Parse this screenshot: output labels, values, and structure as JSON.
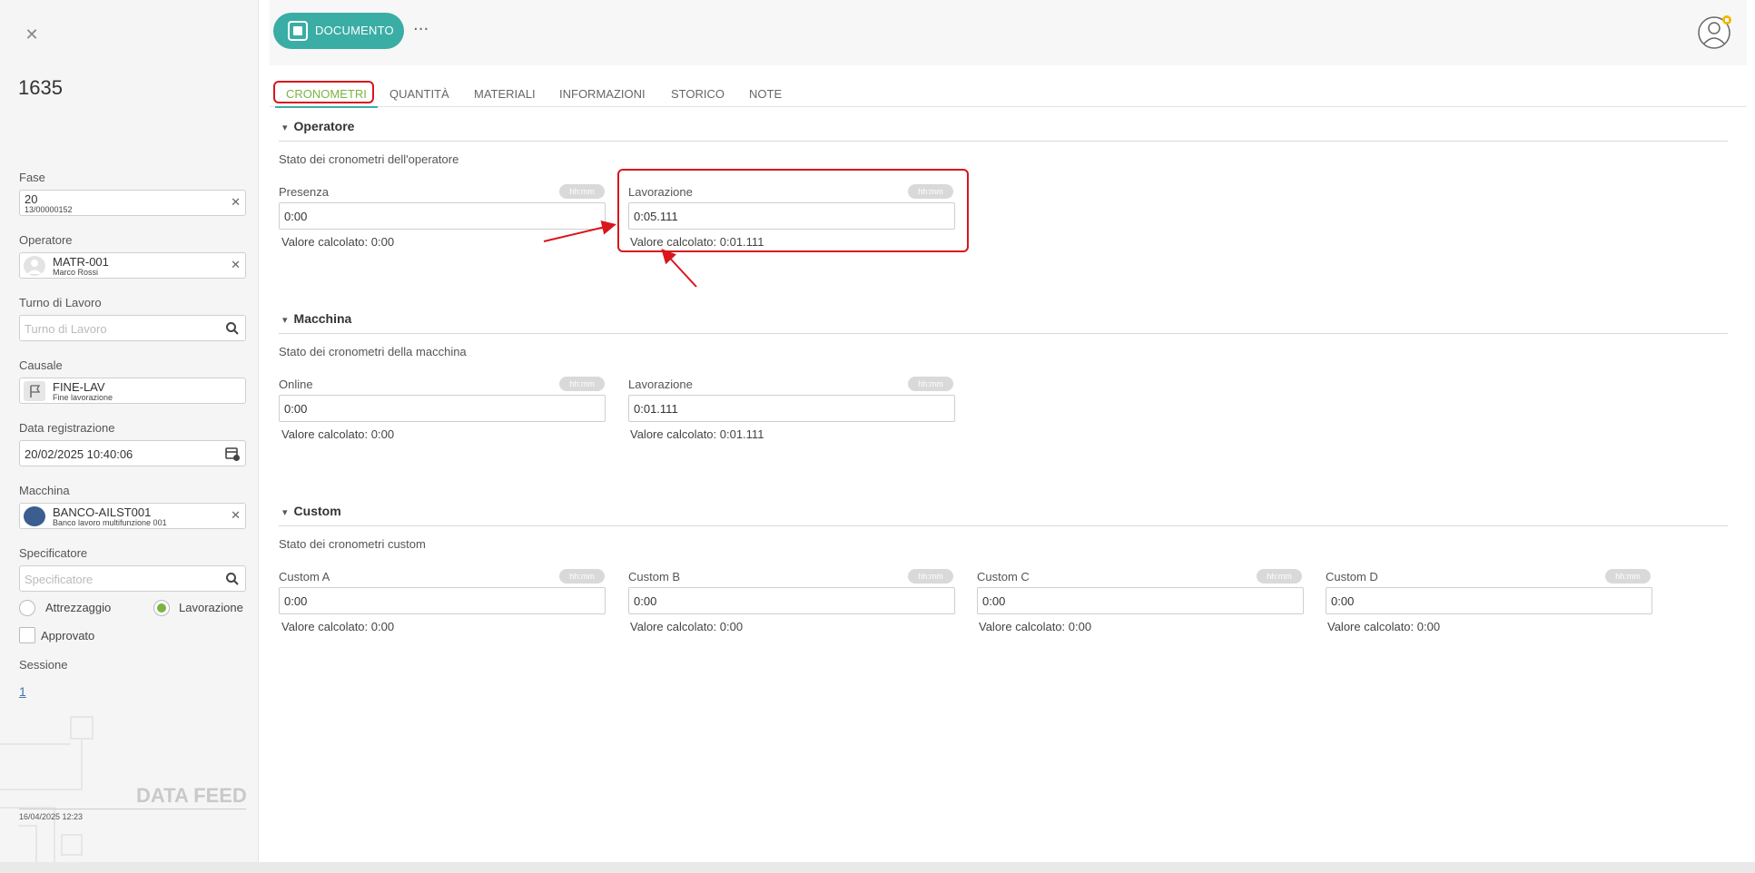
{
  "left_panel": {
    "close_icon": "close-icon",
    "record_number": "1635",
    "fase": {
      "label": "Fase",
      "value": "20",
      "sub": "13/00000152"
    },
    "operatore": {
      "label": "Operatore",
      "value": "MATR-001",
      "sub": "Marco Rossi"
    },
    "turno": {
      "label": "Turno di Lavoro",
      "placeholder": "Turno di Lavoro"
    },
    "causale": {
      "label": "Causale",
      "value": "FINE-LAV",
      "sub": "Fine lavorazione"
    },
    "data_registrazione": {
      "label": "Data registrazione",
      "value": "20/02/2025 10:40:06"
    },
    "macchina": {
      "label": "Macchina",
      "value": "BANCO-AILST001",
      "sub": "Banco lavoro multifunzione 001"
    },
    "specificatore": {
      "label": "Specificatore",
      "placeholder": "Specificatore"
    },
    "radio_attrezzaggio": "Attrezzaggio",
    "radio_lavorazione": "Lavorazione",
    "selected_radio": "Lavorazione",
    "approvato": {
      "label": "Approvato",
      "checked": false
    },
    "sessione": {
      "label": "Sessione",
      "value": "1"
    },
    "brand": "DATA FEED",
    "footer_date": "16/04/2025 12:23"
  },
  "topbar": {
    "document_button": "DOCUMENTO",
    "more_label": "···"
  },
  "tabs": [
    {
      "label": "CRONOMETRI",
      "active": true
    },
    {
      "label": "QUANTITÀ",
      "active": false
    },
    {
      "label": "MATERIALI",
      "active": false
    },
    {
      "label": "INFORMAZIONI",
      "active": false
    },
    {
      "label": "STORICO",
      "active": false
    },
    {
      "label": "NOTE",
      "active": false
    }
  ],
  "unit_badge": "hh:mm",
  "sections": {
    "operatore": {
      "title": "Operatore",
      "subtitle": "Stato dei cronometri dell'operatore",
      "fields": [
        {
          "label": "Presenza",
          "value": "0:00",
          "calc": "Valore calcolato: 0:00"
        },
        {
          "label": "Lavorazione",
          "value": "0:05.111",
          "calc": "Valore calcolato: 0:01.111"
        }
      ]
    },
    "macchina": {
      "title": "Macchina",
      "subtitle": "Stato dei cronometri della macchina",
      "fields": [
        {
          "label": "Online",
          "value": "0:00",
          "calc": "Valore calcolato: 0:00"
        },
        {
          "label": "Lavorazione",
          "value": "0:01.111",
          "calc": "Valore calcolato: 0:01.111"
        }
      ]
    },
    "custom": {
      "title": "Custom",
      "subtitle": "Stato dei cronometri custom",
      "fields": [
        {
          "label": "Custom A",
          "value": "0:00",
          "calc": "Valore calcolato: 0:00"
        },
        {
          "label": "Custom B",
          "value": "0:00",
          "calc": "Valore calcolato: 0:00"
        },
        {
          "label": "Custom C",
          "value": "0:00",
          "calc": "Valore calcolato: 0:00"
        },
        {
          "label": "Custom D",
          "value": "0:00",
          "calc": "Valore calcolato: 0:00"
        }
      ]
    }
  },
  "colors": {
    "accent_teal": "#3aada5",
    "active_tab_green": "#7cb342",
    "annotation_red": "#d9161c"
  }
}
